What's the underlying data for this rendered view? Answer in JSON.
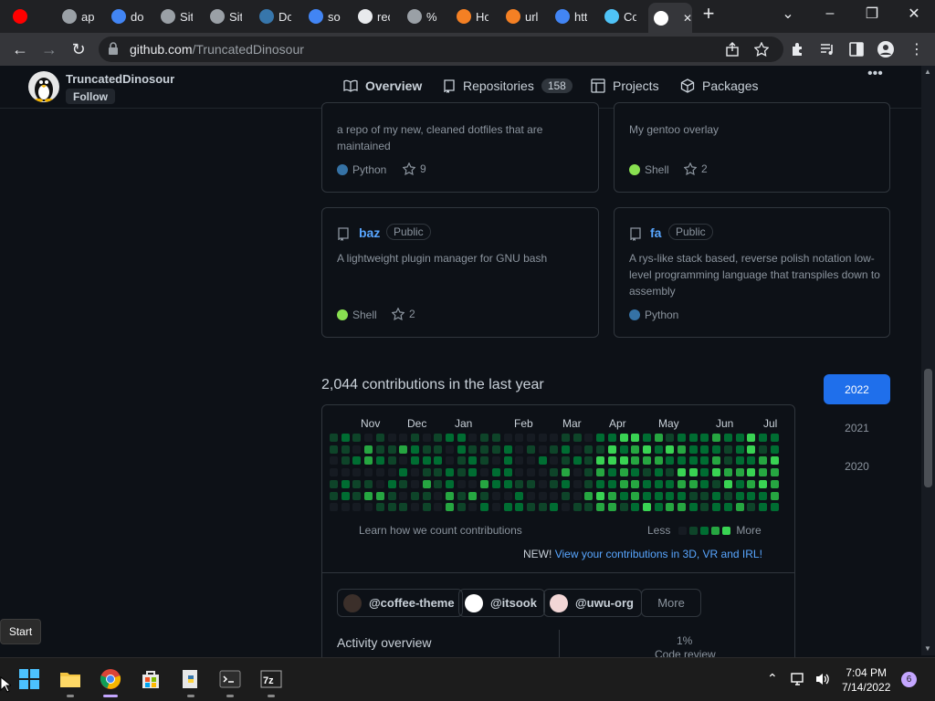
{
  "browser": {
    "tabs": [
      {
        "title": "",
        "color": "#ff0000"
      },
      {
        "title": "ap",
        "color": "#9aa0a6"
      },
      {
        "title": "do",
        "color": "#4285f4"
      },
      {
        "title": "Sit",
        "color": "#9aa0a6"
      },
      {
        "title": "Sit",
        "color": "#9aa0a6"
      },
      {
        "title": "Do",
        "color": "#3776ab"
      },
      {
        "title": "so",
        "color": "#4285f4"
      },
      {
        "title": "rec",
        "color": "#e8eaed"
      },
      {
        "title": "%",
        "color": "#9aa0a6"
      },
      {
        "title": "Ho",
        "color": "#f48024"
      },
      {
        "title": "url",
        "color": "#f48024"
      },
      {
        "title": "htt",
        "color": "#4285f4"
      },
      {
        "title": "Co",
        "color": "#4fc3f7"
      },
      {
        "title": "",
        "color": "#ffffff"
      }
    ],
    "url_host": "github.com",
    "url_path": "/TruncatedDinosour"
  },
  "profile": {
    "username": "TruncatedDinosour",
    "follow_label": "Follow"
  },
  "nav": {
    "overview": "Overview",
    "repositories": "Repositories",
    "repo_count": "158",
    "projects": "Projects",
    "packages": "Packages"
  },
  "repos": [
    {
      "name": "",
      "visibility": "",
      "description": "a repo of my new, cleaned dotfiles that are maintained",
      "language": "Python",
      "lang_color": "#3572A5",
      "stars": "9"
    },
    {
      "name": "",
      "visibility": "",
      "description": "My gentoo overlay",
      "language": "Shell",
      "lang_color": "#89e051",
      "stars": "2"
    },
    {
      "name": "baz",
      "visibility": "Public",
      "description": "A lightweight plugin manager for GNU bash",
      "language": "Shell",
      "lang_color": "#89e051",
      "stars": "2"
    },
    {
      "name": "fa",
      "visibility": "Public",
      "description": "A rys-like stack based, reverse polish notation low-level programming language that transpiles down to assembly",
      "language": "Python",
      "lang_color": "#3572A5",
      "stars": ""
    }
  ],
  "contributions": {
    "title": "2,044 contributions in the last year",
    "months": [
      "Nov",
      "Dec",
      "Jan",
      "Feb",
      "Mar",
      "Apr",
      "May",
      "Jun",
      "Jul"
    ],
    "learn_link": "Learn how we count contributions",
    "legend_less": "Less",
    "legend_more": "More",
    "new_prefix": "NEW!",
    "new_link": "View your contributions in 3D, VR and IRL!",
    "colors": [
      "#161b22",
      "#0e4429",
      "#006d32",
      "#26a641",
      "#39d353"
    ],
    "years": [
      "2022",
      "2021",
      "2020"
    ],
    "selected_year": "2022"
  },
  "orgs": [
    {
      "name": "@coffee-theme",
      "icon_color": "#3b2f2a"
    },
    {
      "name": "@itsook",
      "icon_color": "#ffffff"
    },
    {
      "name": "@uwu-org",
      "icon_color": "#f2d6d6"
    }
  ],
  "more_label": "More",
  "activity": {
    "title": "Activity overview",
    "percent": "1%",
    "category": "Code review"
  },
  "taskbar": {
    "time": "7:04 PM",
    "date": "7/14/2022",
    "notifications": "6",
    "start_tooltip": "Start"
  }
}
